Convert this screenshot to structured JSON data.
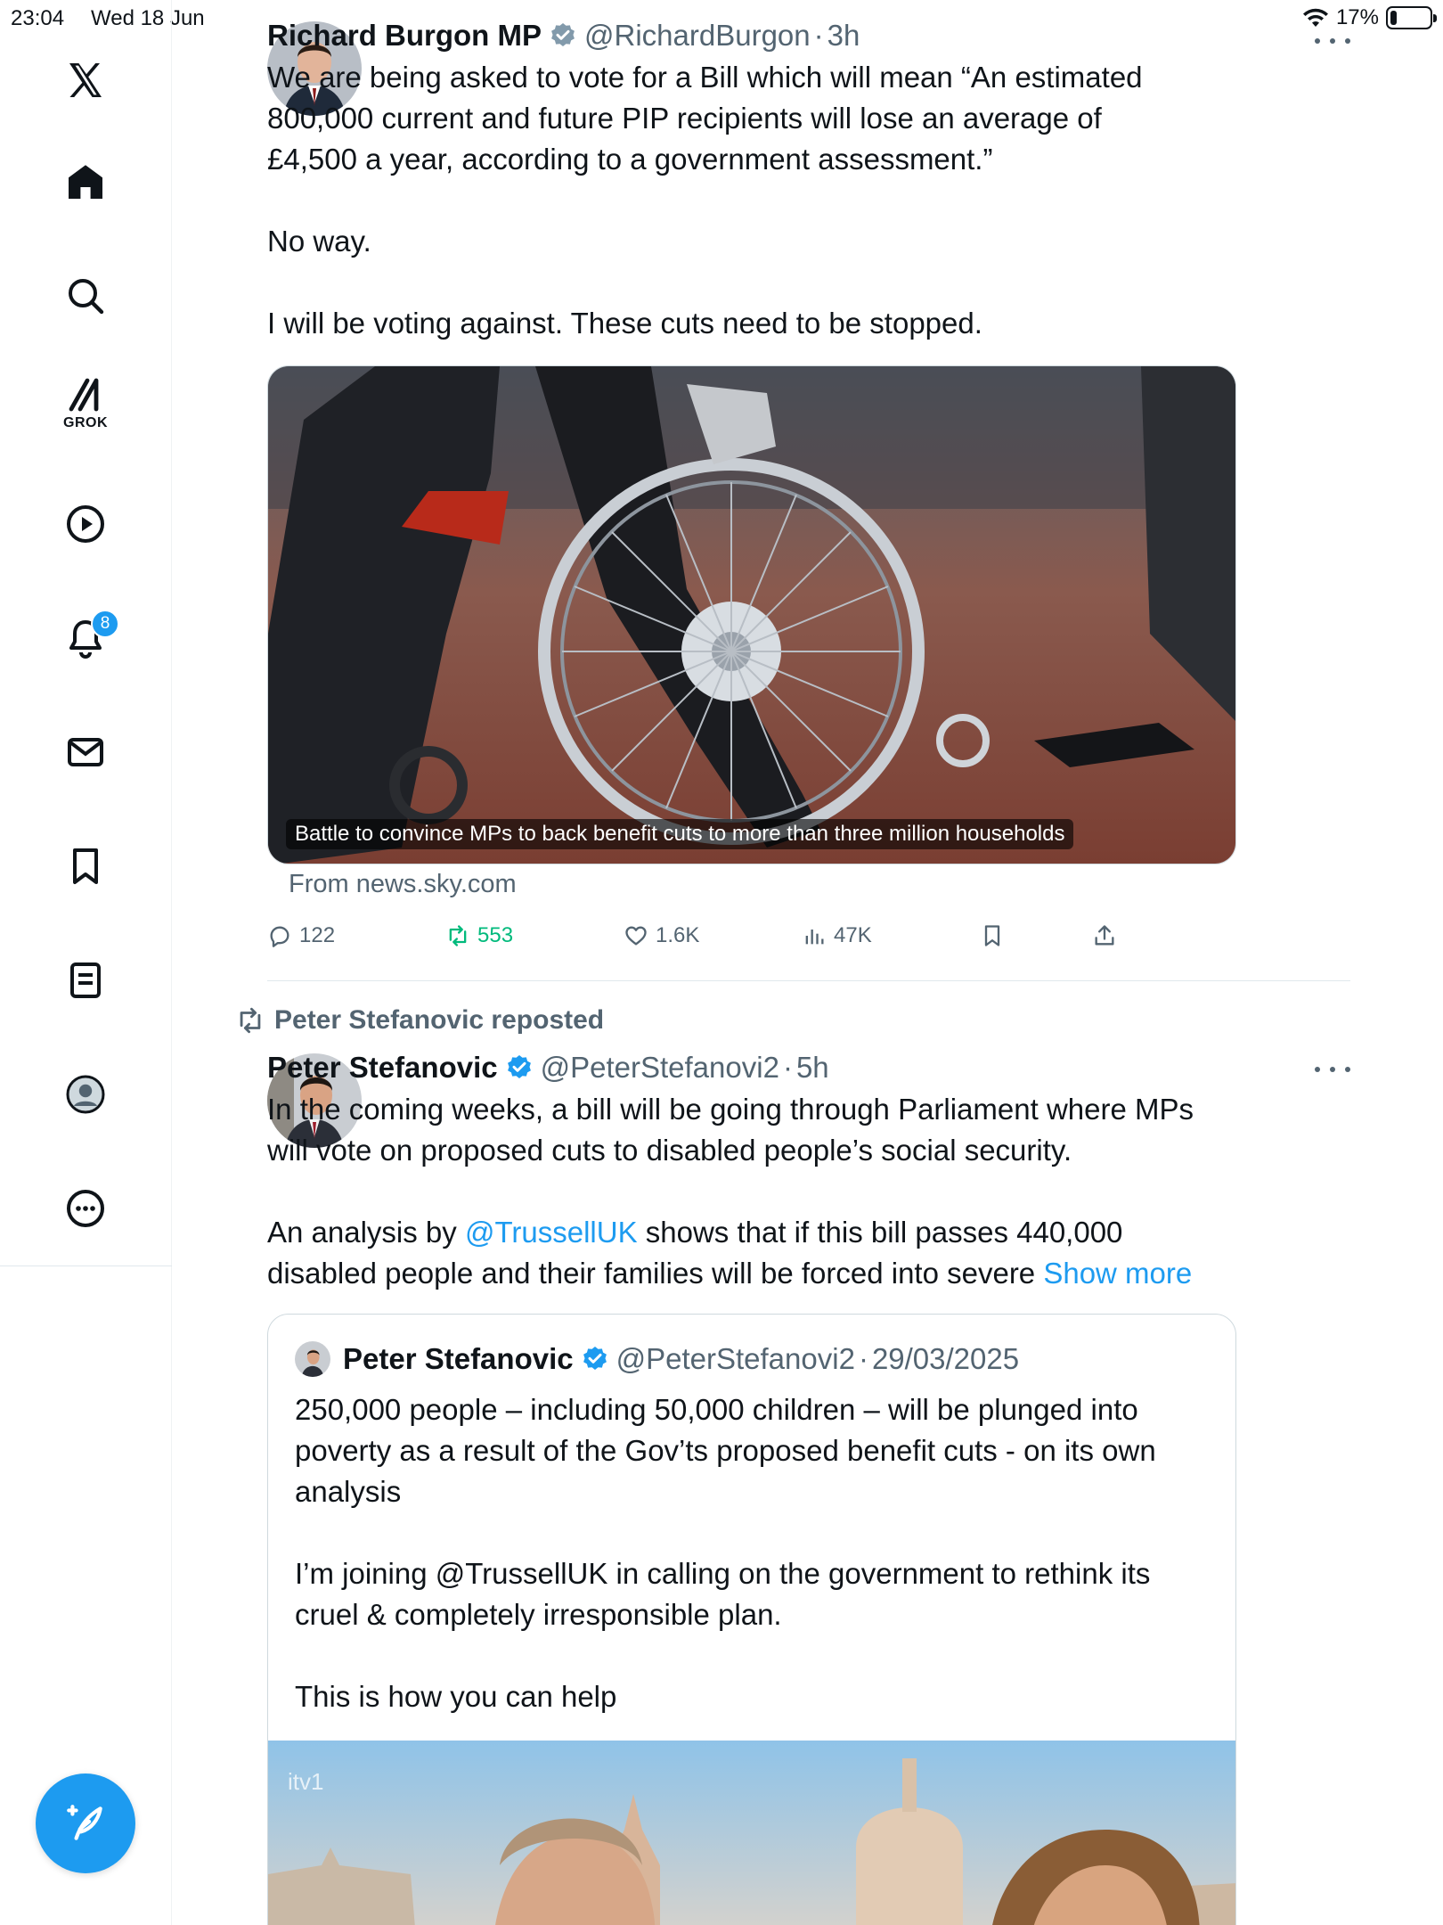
{
  "status_bar": {
    "time": "23:04",
    "date": "Wed 18 Jun",
    "battery": "17%",
    "battery_level": 0.17
  },
  "sidebar": {
    "items": [
      {
        "name": "x-logo",
        "label": ""
      },
      {
        "name": "home",
        "label": ""
      },
      {
        "name": "search",
        "label": ""
      },
      {
        "name": "grok",
        "label": "GROK"
      },
      {
        "name": "video",
        "label": ""
      },
      {
        "name": "notifications",
        "badge": "8"
      },
      {
        "name": "messages",
        "label": ""
      },
      {
        "name": "bookmarks",
        "label": ""
      },
      {
        "name": "lists",
        "label": ""
      },
      {
        "name": "profile",
        "label": ""
      },
      {
        "name": "more",
        "label": ""
      }
    ]
  },
  "tweets": [
    {
      "author": "Richard Burgon MP",
      "handle": "@RichardBurgon",
      "dot": "·",
      "time": "3h",
      "text": "We are being asked to vote for a Bill which will mean “An estimated\n800,000 current and future PIP recipients will lose an average of\n£4,500 a year, according to a government assessment.”\n\nNo way.\n\nI will be voting against. These cuts need to be stopped.",
      "card": {
        "caption": "Battle to convince MPs to back benefit cuts to more than three million households",
        "source": "From news.sky.com"
      },
      "actions": {
        "replies": "122",
        "reposts": "553",
        "likes": "1.6K",
        "views": "47K"
      }
    },
    {
      "reposted_by": "Peter Stefanovic reposted",
      "author": "Peter Stefanovic",
      "handle": "@PeterStefanovi2",
      "dot": "·",
      "time": "5h",
      "text_part1": "In the coming weeks, a bill will be going through Parliament where MPs\nwill vote on proposed cuts to disabled people’s social security.\n\nAn analysis by ",
      "mention": "@TrussellUK",
      "text_part2": " shows that if this bill passes 440,000\ndisabled people and their families will be forced into severe ",
      "show_more": "Show more",
      "quote": {
        "author": "Peter Stefanovic",
        "handle": "@PeterStefanovi2",
        "dot": "·",
        "date": "29/03/2025",
        "text": "250,000 people – including 50,000 children – will be plunged into\npoverty as a result of the Gov’ts proposed benefit cuts - on its own\nanalysis\n\nI’m joining @TrussellUK in calling on the government to rethink its\ncruel & completely irresponsible plan.\n\nThis is how you can help",
        "media_logo": "itv1"
      }
    }
  ],
  "colors": {
    "accent": "#1d9bf0",
    "repost_green": "#00ba7c",
    "muted": "#536471"
  }
}
